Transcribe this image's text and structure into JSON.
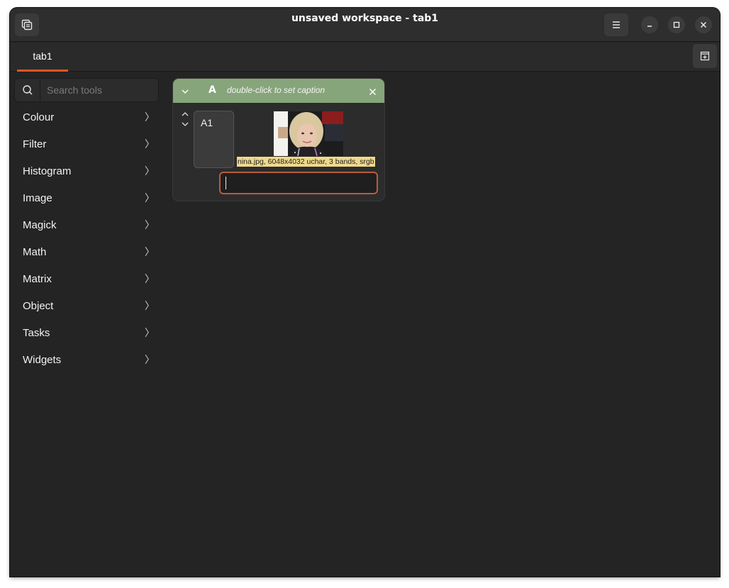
{
  "window": {
    "title": "unsaved workspace - tab1"
  },
  "tabs": [
    {
      "label": "tab1",
      "active": true
    }
  ],
  "search": {
    "placeholder": "Search tools",
    "value": ""
  },
  "menu": {
    "items": [
      {
        "label": "Colour"
      },
      {
        "label": "Filter"
      },
      {
        "label": "Histogram"
      },
      {
        "label": "Image"
      },
      {
        "label": "Magick"
      },
      {
        "label": "Math"
      },
      {
        "label": "Matrix"
      },
      {
        "label": "Object"
      },
      {
        "label": "Tasks"
      },
      {
        "label": "Widgets"
      }
    ]
  },
  "node": {
    "header_icon_letter": "A",
    "caption_placeholder": "double-click to set caption",
    "row_name": "A1",
    "image_info": "nina.jpg, 6048x4032 uchar, 3 bands, srgb",
    "expression_value": ""
  },
  "colors": {
    "accent": "#e95420",
    "node_header": "#87a57b",
    "info_label_bg": "#f0d98a",
    "input_border": "#b85c40"
  },
  "icons": {
    "app_menu": "stacked-documents-icon",
    "hamburger": "hamburger-menu-icon",
    "minimize": "minimize-icon",
    "maximize": "maximize-icon",
    "close": "close-icon",
    "new_tab": "new-tab-icon",
    "search": "search-icon",
    "submenu": "chevron-right-icon",
    "collapse": "chevron-down-icon",
    "node_close": "close-icon"
  }
}
